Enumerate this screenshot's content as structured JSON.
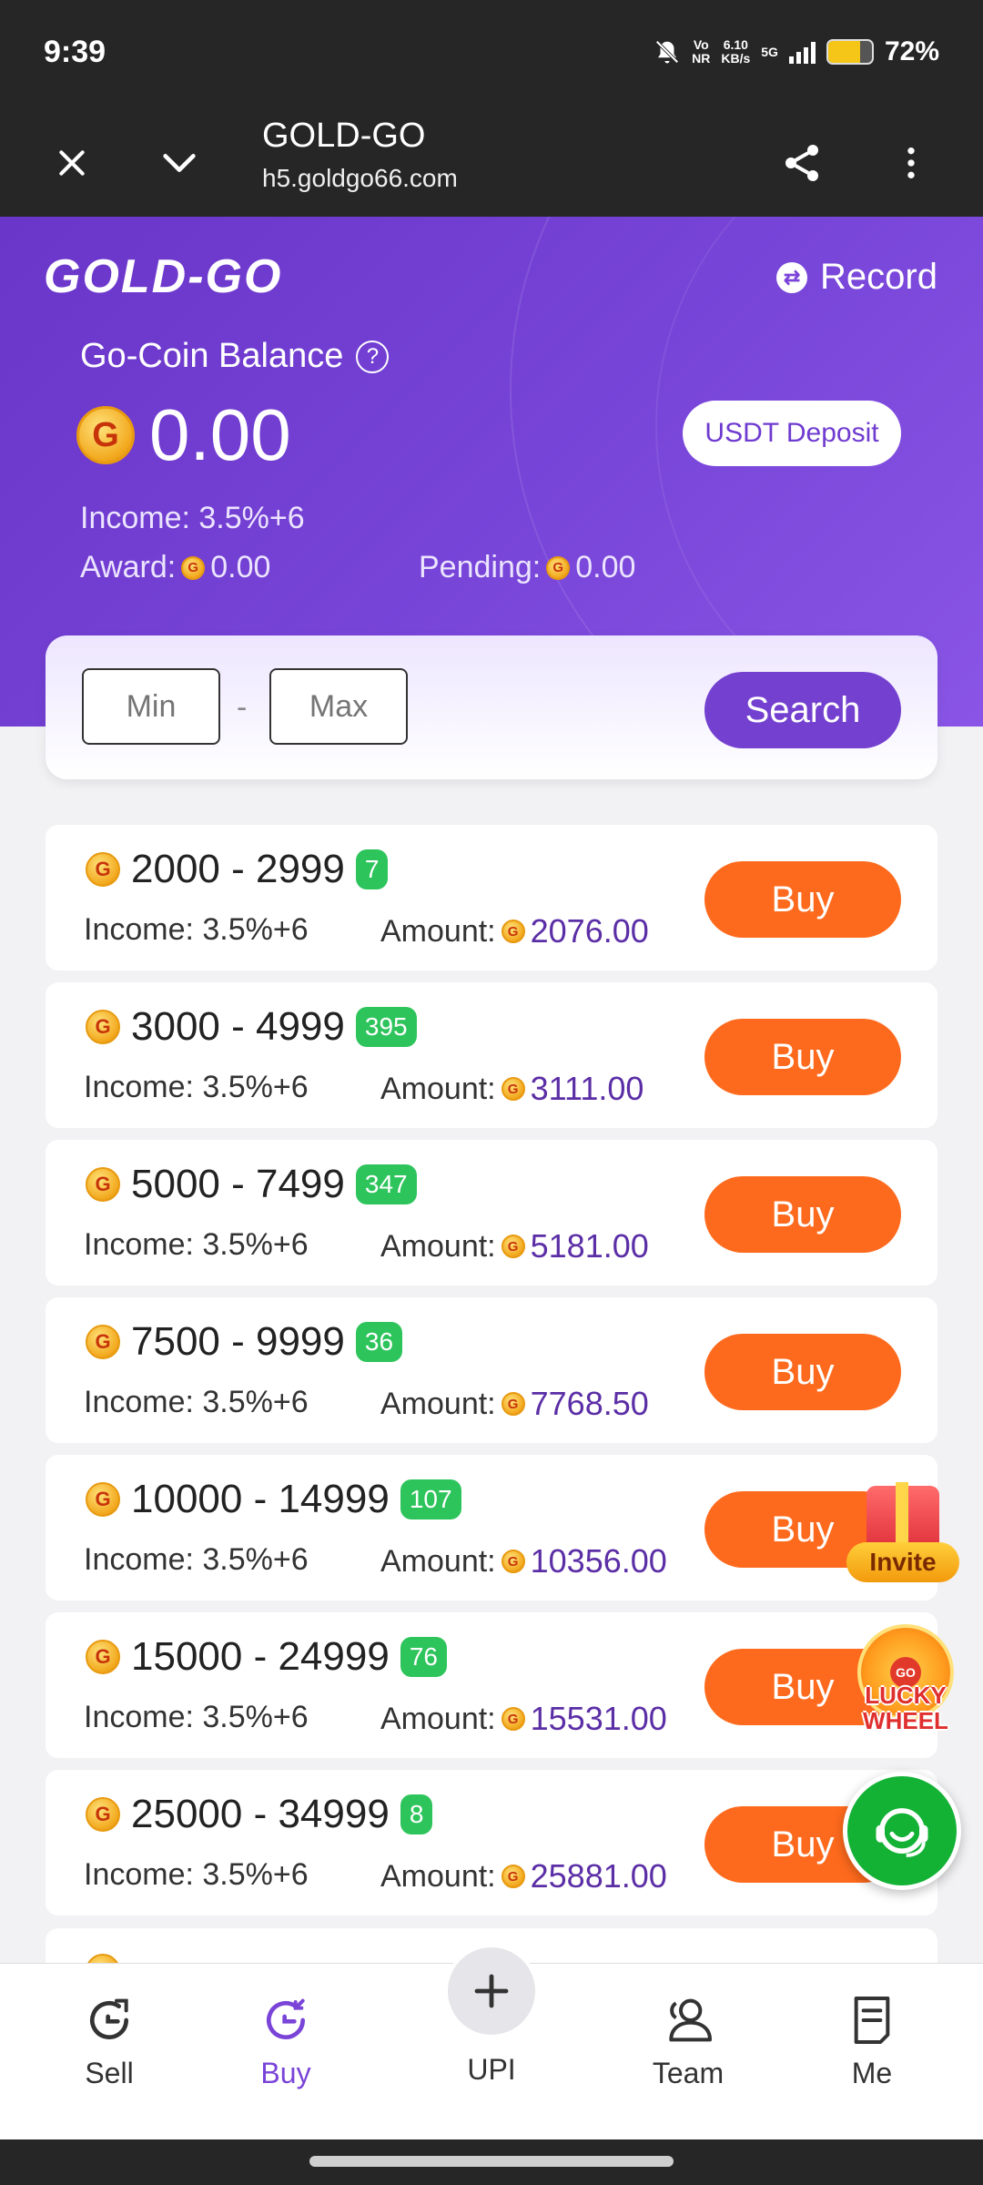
{
  "status_bar": {
    "time": "9:39",
    "vo_top": "Vo",
    "vo_bottom": "NR",
    "speed_top": "6.10",
    "speed_bottom": "KB/s",
    "network": "5G",
    "battery": "72%",
    "battery_level": 0.72
  },
  "browser": {
    "title": "GOLD-GO",
    "url": "h5.goldgo66.com"
  },
  "header": {
    "logo": "GOLD-GO",
    "record_label": "Record",
    "record_icon": "⇄"
  },
  "balance": {
    "label": "Go-Coin Balance",
    "help_icon": "?",
    "coin_symbol": "G",
    "value": "0.00",
    "deposit_label": "USDT Deposit",
    "income": "Income: 3.5%+6",
    "award_label": "Award:",
    "award_value": "0.00",
    "pending_label": "Pending:",
    "pending_value": "0.00"
  },
  "search": {
    "min_placeholder": "Min",
    "max_placeholder": "Max",
    "separator": "-",
    "button_label": "Search"
  },
  "products": [
    {
      "range": "2000 - 2999",
      "count": "7",
      "income": "Income: 3.5%+6",
      "amount_label": "Amount:",
      "amount": "2076.00",
      "buy": "Buy"
    },
    {
      "range": "3000 - 4999",
      "count": "395",
      "income": "Income: 3.5%+6",
      "amount_label": "Amount:",
      "amount": "3111.00",
      "buy": "Buy"
    },
    {
      "range": "5000 - 7499",
      "count": "347",
      "income": "Income: 3.5%+6",
      "amount_label": "Amount:",
      "amount": "5181.00",
      "buy": "Buy"
    },
    {
      "range": "7500 - 9999",
      "count": "36",
      "income": "Income: 3.5%+6",
      "amount_label": "Amount:",
      "amount": "7768.50",
      "buy": "Buy"
    },
    {
      "range": "10000 - 14999",
      "count": "107",
      "income": "Income: 3.5%+6",
      "amount_label": "Amount:",
      "amount": "10356.00",
      "buy": "Buy"
    },
    {
      "range": "15000 - 24999",
      "count": "76",
      "income": "Income: 3.5%+6",
      "amount_label": "Amount:",
      "amount": "15531.00",
      "buy": "Buy"
    },
    {
      "range": "25000 - 34999",
      "count": "8",
      "income": "Income: 3.5%+6",
      "amount_label": "Amount:",
      "amount": "25881.00",
      "buy": "Buy"
    }
  ],
  "floating": {
    "invite_label": "Invite",
    "wheel_top": "LUCKY",
    "wheel_bottom": "WHEEL",
    "wheel_hub": "GO"
  },
  "nav": {
    "items": [
      {
        "label": "Sell",
        "icon": "sell-icon"
      },
      {
        "label": "Buy",
        "icon": "buy-icon"
      },
      {
        "label": "UPI",
        "icon": "plus-icon"
      },
      {
        "label": "Team",
        "icon": "team-icon"
      },
      {
        "label": "Me",
        "icon": "me-icon"
      }
    ],
    "active": "Buy"
  },
  "colors": {
    "brand_purple": "#7440cf",
    "buy_orange": "#fe6a1d",
    "badge_green": "#2ec45c",
    "support_green": "#13b235",
    "amount_purple": "#5b2ea6"
  }
}
